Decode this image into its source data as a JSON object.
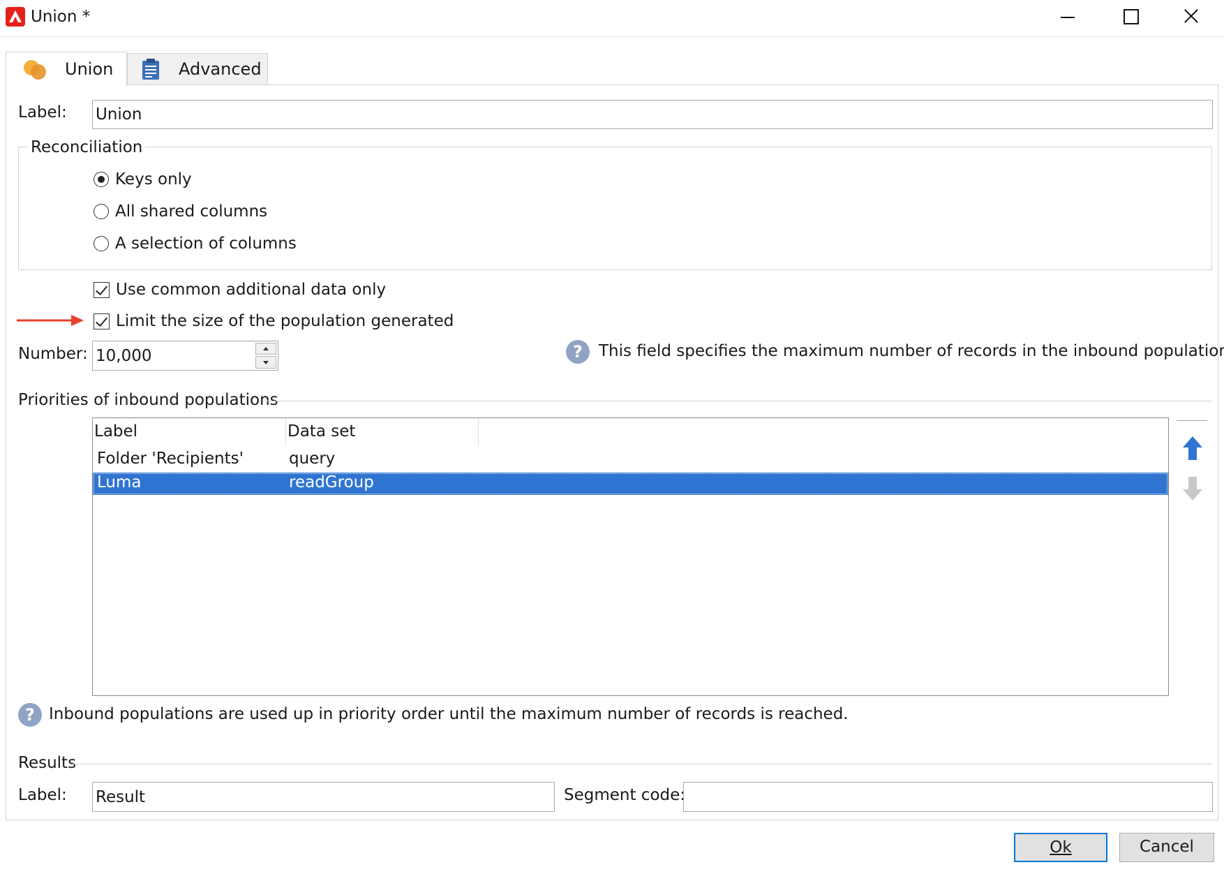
{
  "window": {
    "title": "Union *"
  },
  "tabs": [
    {
      "label": "Union",
      "icon": "union-circles-icon",
      "active": true
    },
    {
      "label": "Advanced",
      "icon": "clipboard-icon",
      "active": false
    }
  ],
  "general": {
    "label_caption": "Label:",
    "label_value": "Union"
  },
  "reconciliation": {
    "title": "Reconciliation",
    "options": [
      {
        "label": "Keys only",
        "selected": true
      },
      {
        "label": "All shared columns",
        "selected": false
      },
      {
        "label": "A selection of columns",
        "selected": false
      }
    ]
  },
  "options": {
    "common_data": {
      "label": "Use common additional data only",
      "checked": true
    },
    "limit_size": {
      "label": "Limit the size of the population generated",
      "checked": true
    }
  },
  "number": {
    "caption": "Number:",
    "value": "10,000",
    "help": "This field specifies the maximum number of records in the inbound populations."
  },
  "priorities": {
    "title": "Priorities of inbound populations",
    "columns": [
      "Label",
      "Data set"
    ],
    "rows": [
      {
        "label": "Folder 'Recipients'",
        "dataset": "query",
        "selected": false
      },
      {
        "label": "Luma",
        "dataset": "readGroup",
        "selected": true
      }
    ],
    "help": "Inbound populations are used up in priority order until the maximum number of records is reached."
  },
  "results": {
    "title": "Results",
    "label_caption": "Label:",
    "label_value": "Result",
    "segment_caption": "Segment code:",
    "segment_value": ""
  },
  "buttons": {
    "ok": "Ok",
    "cancel": "Cancel"
  },
  "colors": {
    "selection": "#2f74d0",
    "arrow_annotation": "#e8412c",
    "help_icon": "#8fa3c4",
    "move_up": "#2f74d0",
    "move_down": "#c8c8c8"
  }
}
